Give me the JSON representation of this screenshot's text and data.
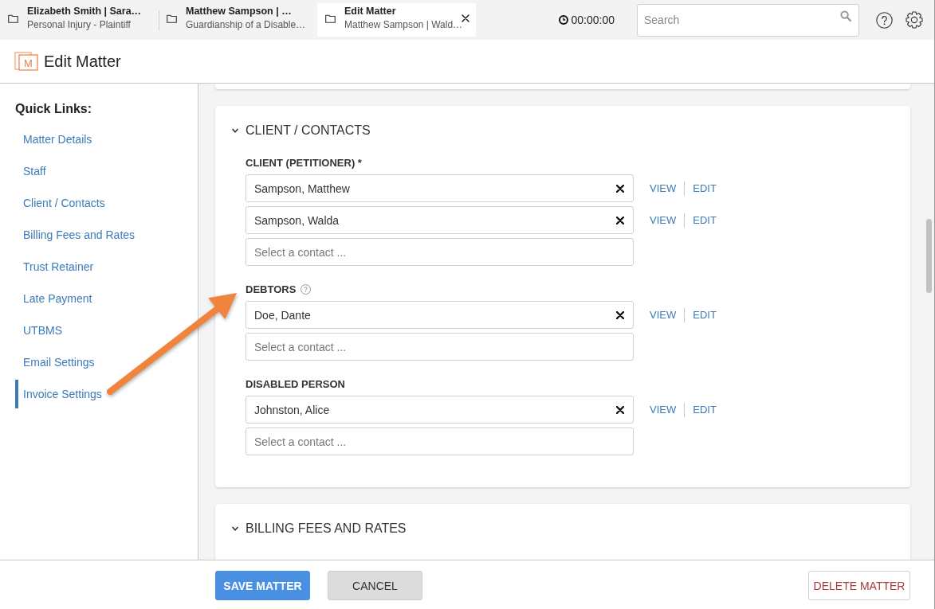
{
  "tabs": [
    {
      "title": "Elizabeth Smith | Sara…",
      "subtitle": "Personal Injury - Plaintiff",
      "selected": false
    },
    {
      "title": "Matthew Sampson | …",
      "subtitle": "Guardianship of a Disable…",
      "selected": false
    },
    {
      "title": "Edit Matter",
      "subtitle": "Matthew Sampson | Wald…",
      "selected": true
    }
  ],
  "timer": "00:00:00",
  "search": {
    "placeholder": "Search"
  },
  "page": {
    "logo_letter": "M",
    "title": "Edit Matter"
  },
  "quick_links": {
    "heading": "Quick Links:",
    "items": [
      {
        "label": "Matter Details",
        "selected": false
      },
      {
        "label": "Staff",
        "selected": false
      },
      {
        "label": "Client / Contacts",
        "selected": false
      },
      {
        "label": "Billing Fees and Rates",
        "selected": false
      },
      {
        "label": "Trust Retainer",
        "selected": false
      },
      {
        "label": "Late Payment",
        "selected": false
      },
      {
        "label": "UTBMS",
        "selected": false
      },
      {
        "label": "Email Settings",
        "selected": false
      },
      {
        "label": "Invoice Settings",
        "selected": true
      }
    ]
  },
  "sections": [
    {
      "title": "CLIENT / CONTACTS",
      "expanded": true,
      "fields": [
        {
          "label": "CLIENT (PETITIONER) *",
          "help": false,
          "contacts": [
            {
              "name": "Sampson, Matthew",
              "actions": [
                "VIEW",
                "EDIT"
              ]
            },
            {
              "name": "Sampson, Walda",
              "actions": [
                "VIEW",
                "EDIT"
              ]
            }
          ],
          "placeholder": "Select a contact ..."
        },
        {
          "label": "DEBTORS",
          "help": true,
          "contacts": [
            {
              "name": "Doe, Dante",
              "actions": [
                "VIEW",
                "EDIT"
              ]
            }
          ],
          "placeholder": "Select a contact ..."
        },
        {
          "label": "DISABLED PERSON",
          "help": false,
          "contacts": [
            {
              "name": "Johnston, Alice",
              "actions": [
                "VIEW",
                "EDIT"
              ]
            }
          ],
          "placeholder": "Select a contact ..."
        }
      ]
    },
    {
      "title": "BILLING FEES AND RATES",
      "expanded": true
    }
  ],
  "buttons": [
    {
      "label": "SAVE MATTER",
      "kind": "primary"
    },
    {
      "label": "CANCEL",
      "kind": "secondary"
    },
    {
      "label": "DELETE MATTER",
      "kind": "danger"
    }
  ]
}
